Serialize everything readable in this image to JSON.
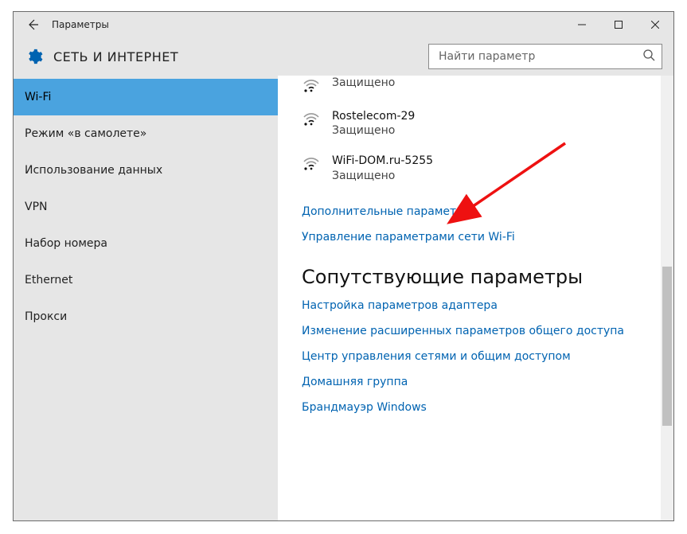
{
  "window": {
    "title": "Параметры",
    "section": "СЕТЬ И ИНТЕРНЕТ"
  },
  "search": {
    "placeholder": "Найти параметр"
  },
  "sidebar": {
    "items": [
      {
        "label": "Wi-Fi",
        "selected": true
      },
      {
        "label": "Режим «в самолете»",
        "selected": false
      },
      {
        "label": "Использование данных",
        "selected": false
      },
      {
        "label": "VPN",
        "selected": false
      },
      {
        "label": "Набор номера",
        "selected": false
      },
      {
        "label": "Ethernet",
        "selected": false
      },
      {
        "label": "Прокси",
        "selected": false
      }
    ]
  },
  "wifi": {
    "networks": [
      {
        "name": "",
        "status": "Защищено",
        "truncated": true
      },
      {
        "name": "Rostelecom-29",
        "status": "Защищено",
        "truncated": false
      },
      {
        "name": "WiFi-DOM.ru-5255",
        "status": "Защищено",
        "truncated": false
      }
    ]
  },
  "links": {
    "advanced": "Дополнительные параметры",
    "manage": "Управление параметрами сети Wi-Fi"
  },
  "related": {
    "heading": "Сопутствующие параметры",
    "items": [
      "Настройка параметров адаптера",
      "Изменение расширенных параметров общего доступа",
      "Центр управления сетями и общим доступом",
      "Домашняя группа",
      "Брандмауэр Windows"
    ]
  }
}
